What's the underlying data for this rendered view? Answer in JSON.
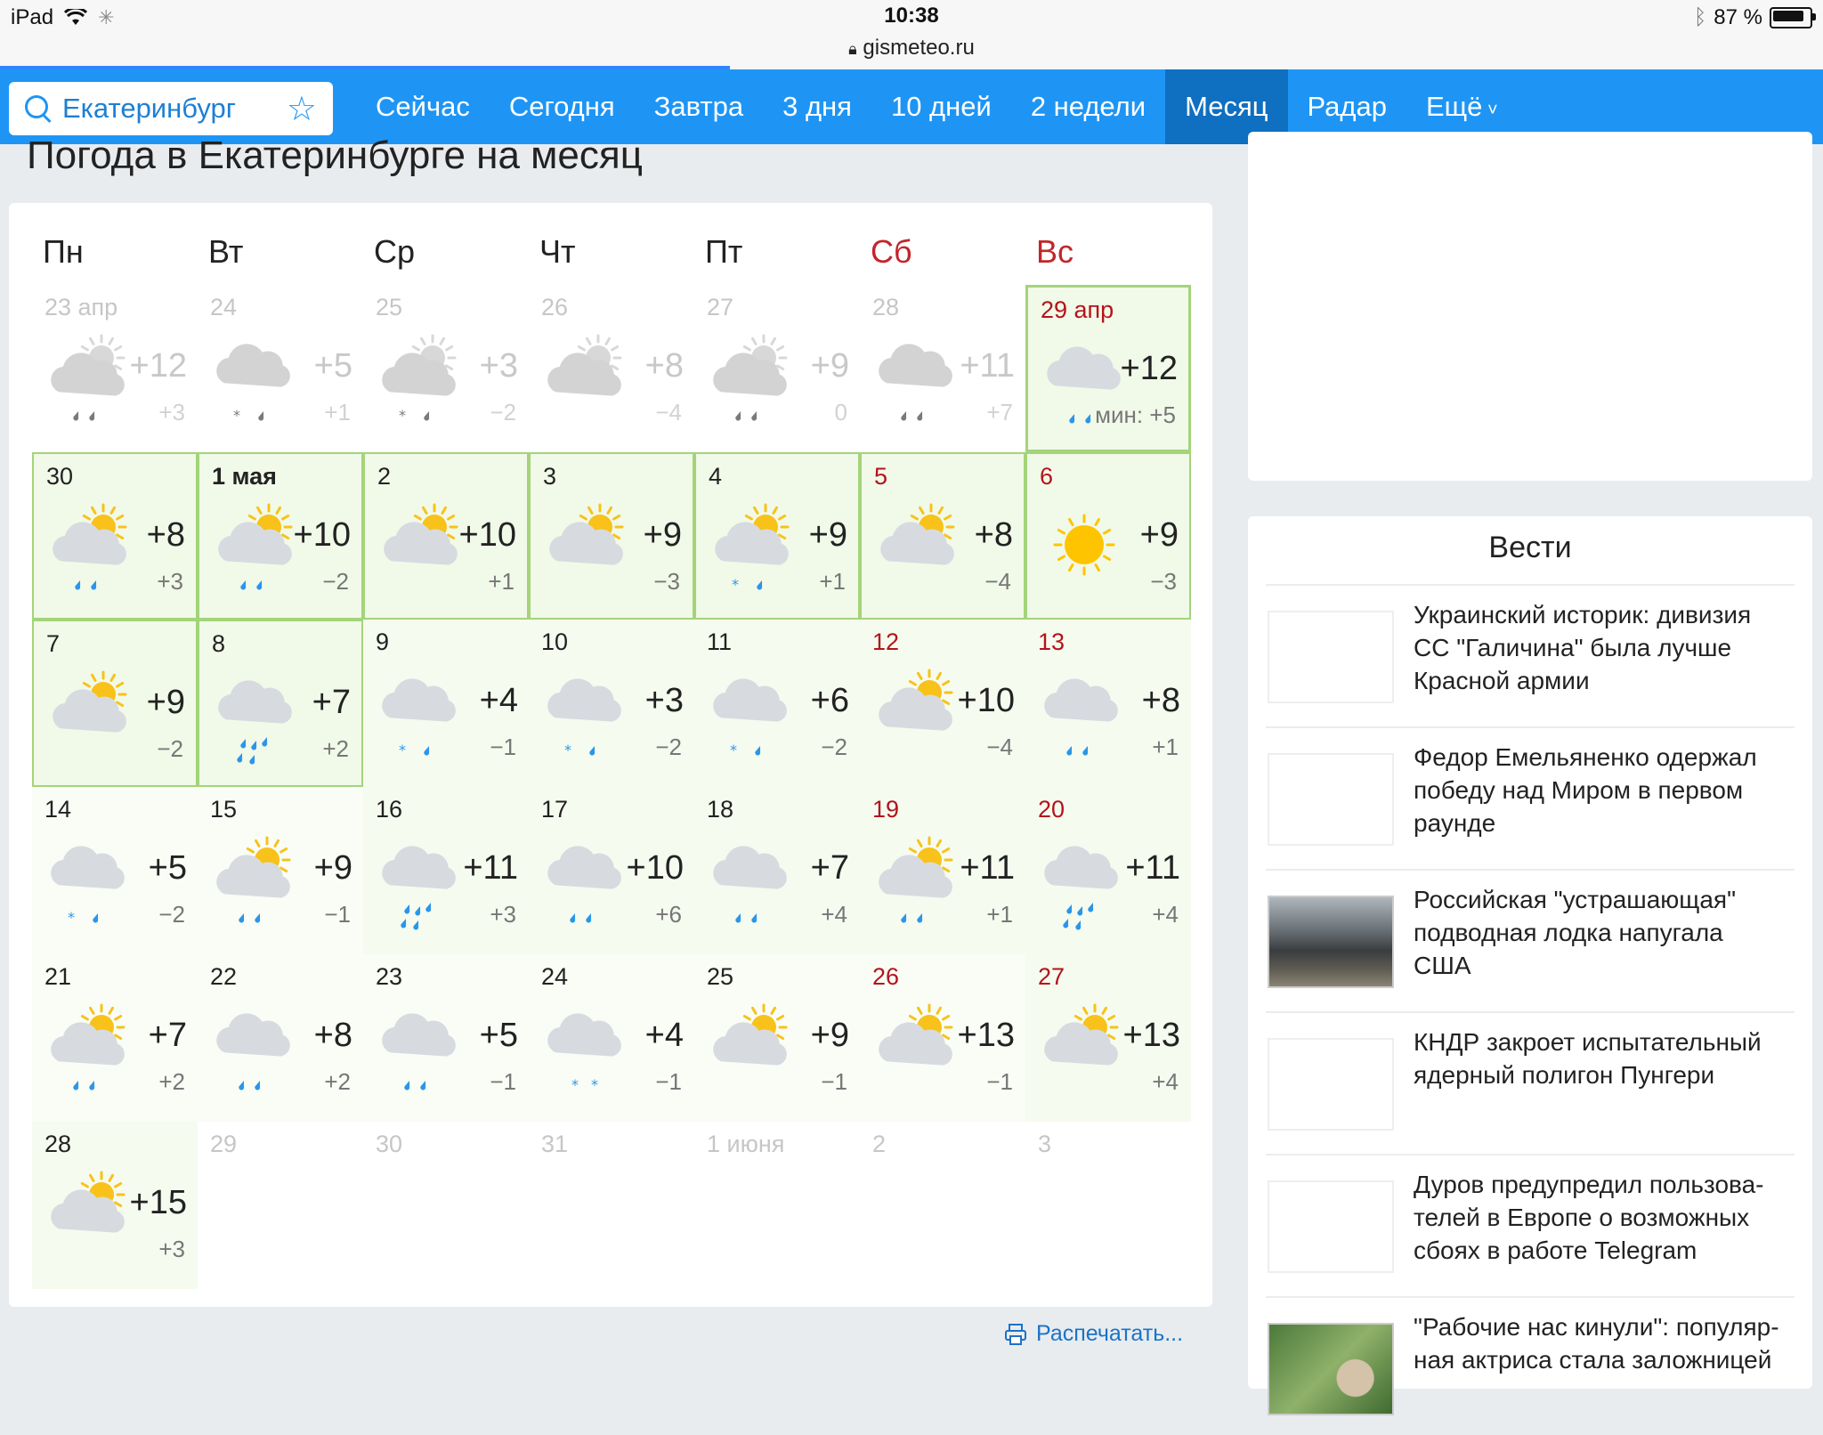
{
  "status_bar": {
    "device": "iPad",
    "time": "10:38",
    "url": "gismeteo.ru",
    "battery": "87 %"
  },
  "nav": {
    "search_value": "Екатеринбург",
    "items": [
      "Сейчас",
      "Сегодня",
      "Завтра",
      "3 дня",
      "10 дней",
      "2 недели",
      "Месяц",
      "Радар",
      "Ещё"
    ],
    "active": "Месяц"
  },
  "page_title": "Погода в Екатеринбурге на месяц",
  "weekdays": [
    "Пн",
    "Вт",
    "Ср",
    "Чт",
    "Пт",
    "Сб",
    "Вс"
  ],
  "weeks": [
    [
      {
        "date": "23 апр",
        "max": "+12",
        "min": "+3",
        "icon": "cloud-sun-rain",
        "state": "past"
      },
      {
        "date": "24",
        "max": "+5",
        "min": "+1",
        "icon": "cloud-snow-rain",
        "state": "past"
      },
      {
        "date": "25",
        "max": "+3",
        "min": "−2",
        "icon": "cloud-sun-snow-rain",
        "state": "past"
      },
      {
        "date": "26",
        "max": "+8",
        "min": "−4",
        "icon": "cloud-sun",
        "state": "past"
      },
      {
        "date": "27",
        "max": "+9",
        "min": "0",
        "icon": "cloud-sun-rain",
        "state": "past"
      },
      {
        "date": "28",
        "max": "+11",
        "min": "+7",
        "icon": "cloud-rain",
        "state": "past"
      },
      {
        "date": "29 апр",
        "max": "+12",
        "min": "мин: +5",
        "icon": "cloud-rain",
        "state": "today"
      }
    ],
    [
      {
        "date": "30",
        "max": "+8",
        "min": "+3",
        "icon": "sun-cloud-rain",
        "state": "g1"
      },
      {
        "date": "1 мая",
        "max": "+10",
        "min": "−2",
        "icon": "sun-cloud-rain",
        "state": "g1",
        "bold": true
      },
      {
        "date": "2",
        "max": "+10",
        "min": "+1",
        "icon": "sun-cloud",
        "state": "g1"
      },
      {
        "date": "3",
        "max": "+9",
        "min": "−3",
        "icon": "sun-cloud",
        "state": "g1"
      },
      {
        "date": "4",
        "max": "+9",
        "min": "+1",
        "icon": "sun-cloud-snow-rain",
        "state": "g1"
      },
      {
        "date": "5",
        "max": "+8",
        "min": "−4",
        "icon": "sun-cloud",
        "state": "g1"
      },
      {
        "date": "6",
        "max": "+9",
        "min": "−3",
        "icon": "sun",
        "state": "g1"
      }
    ],
    [
      {
        "date": "7",
        "max": "+9",
        "min": "−2",
        "icon": "sun-cloud",
        "state": "g1"
      },
      {
        "date": "8",
        "max": "+7",
        "min": "+2",
        "icon": "cloud-rain-heavy",
        "state": "g1"
      },
      {
        "date": "9",
        "max": "+4",
        "min": "−1",
        "icon": "cloud-snow-rain",
        "state": "g2"
      },
      {
        "date": "10",
        "max": "+3",
        "min": "−2",
        "icon": "cloud-snow-rain",
        "state": "g2"
      },
      {
        "date": "11",
        "max": "+6",
        "min": "−2",
        "icon": "cloud-snow-rain",
        "state": "g2"
      },
      {
        "date": "12",
        "max": "+10",
        "min": "−4",
        "icon": "sun-cloud",
        "state": "g2"
      },
      {
        "date": "13",
        "max": "+8",
        "min": "+1",
        "icon": "cloud-rain",
        "state": "g2"
      }
    ],
    [
      {
        "date": "14",
        "max": "+5",
        "min": "−2",
        "icon": "cloud-snow-rain",
        "state": "g3"
      },
      {
        "date": "15",
        "max": "+9",
        "min": "−1",
        "icon": "sun-cloud-rain",
        "state": "g3"
      },
      {
        "date": "16",
        "max": "+11",
        "min": "+3",
        "icon": "cloud-rain-heavy",
        "state": "g2"
      },
      {
        "date": "17",
        "max": "+10",
        "min": "+6",
        "icon": "cloud-rain",
        "state": "g2"
      },
      {
        "date": "18",
        "max": "+7",
        "min": "+4",
        "icon": "cloud-rain",
        "state": "g2"
      },
      {
        "date": "19",
        "max": "+11",
        "min": "+1",
        "icon": "sun-cloud-rain",
        "state": "g2"
      },
      {
        "date": "20",
        "max": "+11",
        "min": "+4",
        "icon": "cloud-rain-heavy",
        "state": "g2"
      }
    ],
    [
      {
        "date": "21",
        "max": "+7",
        "min": "+2",
        "icon": "sun-cloud-rain",
        "state": "g3"
      },
      {
        "date": "22",
        "max": "+8",
        "min": "+2",
        "icon": "cloud-rain",
        "state": "g3"
      },
      {
        "date": "23",
        "max": "+5",
        "min": "−1",
        "icon": "cloud-rain",
        "state": "g3"
      },
      {
        "date": "24",
        "max": "+4",
        "min": "−1",
        "icon": "cloud-snow",
        "state": "g3"
      },
      {
        "date": "25",
        "max": "+9",
        "min": "−1",
        "icon": "sun-cloud",
        "state": "g3"
      },
      {
        "date": "26",
        "max": "+13",
        "min": "−1",
        "icon": "sun-cloud",
        "state": "g3"
      },
      {
        "date": "27",
        "max": "+13",
        "min": "+4",
        "icon": "sun-cloud",
        "state": "g2"
      }
    ],
    [
      {
        "date": "28",
        "max": "+15",
        "min": "+3",
        "icon": "sun-cloud",
        "state": "g2"
      },
      {
        "date": "29",
        "max": "",
        "min": "",
        "icon": "",
        "state": "empty"
      },
      {
        "date": "30",
        "max": "",
        "min": "",
        "icon": "",
        "state": "empty"
      },
      {
        "date": "31",
        "max": "",
        "min": "",
        "icon": "",
        "state": "empty"
      },
      {
        "date": "1 июня",
        "max": "",
        "min": "",
        "icon": "",
        "state": "empty"
      },
      {
        "date": "2",
        "max": "",
        "min": "",
        "icon": "",
        "state": "empty"
      },
      {
        "date": "3",
        "max": "",
        "min": "",
        "icon": "",
        "state": "empty"
      }
    ]
  ],
  "sidebar": {
    "news_header": "Вести",
    "news": [
      {
        "text": "Украинский историк: дивизия СС \"Галичина\" была лучше Красной армии",
        "thumb": "blank"
      },
      {
        "text": "Федор Емельяненко одержал победу над Миром в первом раунде",
        "thumb": "blank"
      },
      {
        "text": "Российская \"устрашающая\" подводная лодка напугала США",
        "thumb": "sub"
      },
      {
        "text": "КНДР закроет испытательный ядерный полигон Пунгери",
        "thumb": "blank"
      },
      {
        "text": "Дуров предупредил пользова-телей в Европе о возможных сбоях в работе Telegram",
        "thumb": "blank"
      },
      {
        "text": "\"Рабочие нас кинули\": популяр-ная актриса стала заложницей",
        "thumb": "plant"
      }
    ]
  },
  "print_label": "Распечатать...",
  "colors": {
    "nav": "#1e95f5",
    "nav_active": "#0f6fc0",
    "weekend": "#c1262a",
    "link": "#1a73c7"
  }
}
